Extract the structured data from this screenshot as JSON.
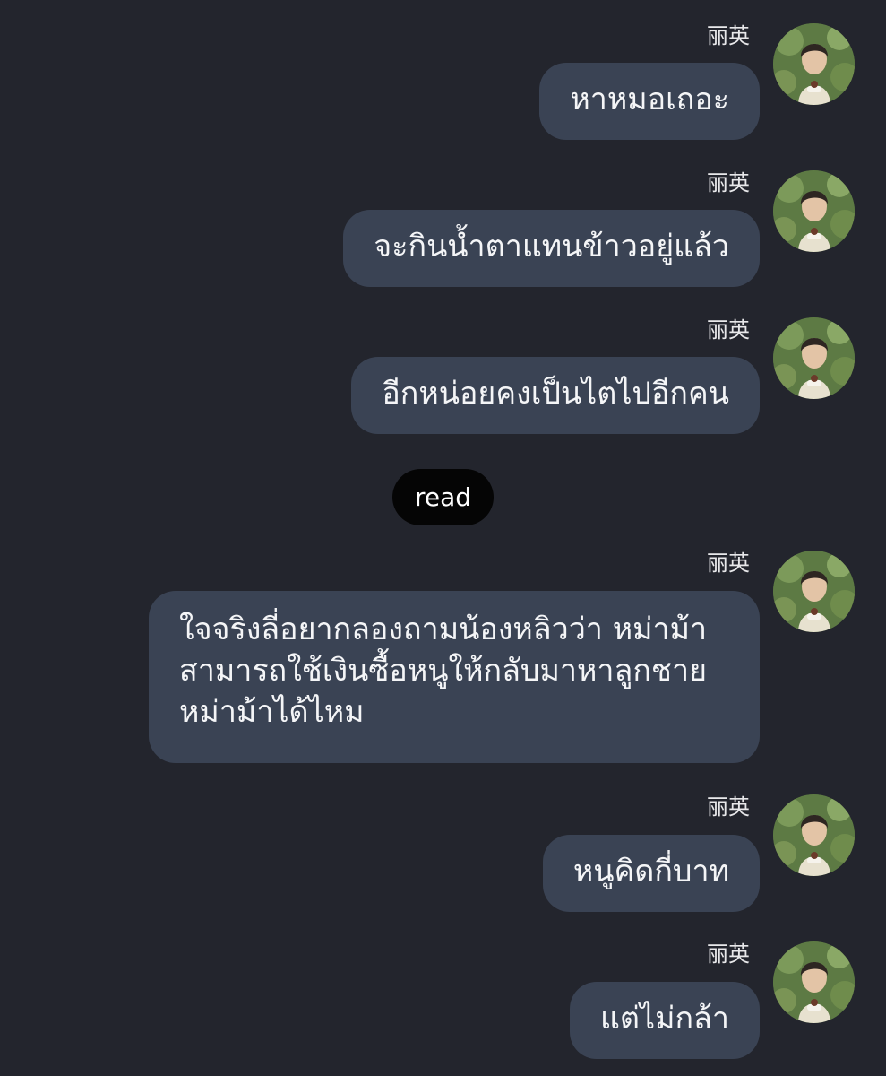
{
  "read_label": "read",
  "messages": [
    {
      "sender": "丽英",
      "text": "หาหมอเถอะ"
    },
    {
      "sender": "丽英",
      "text": "จะกินน้ำตาแทนข้าวอยู่แล้ว"
    },
    {
      "sender": "丽英",
      "text": "อีกหน่อยคงเป็นไตไปอีกคน"
    },
    {
      "sender": "丽英",
      "lines": [
        "ใจจริงลี่อยากลองถามน้องหลิวว่า หม่าม้า",
        "สามารถใช้เงินซื้อหนูให้กลับมาหาลูกชาย",
        "หม่าม้าได้ไหม"
      ]
    },
    {
      "sender": "丽英",
      "text": "หนูคิดกี่บาท"
    },
    {
      "sender": "丽英",
      "text": "แต่ไม่กล้า"
    }
  ]
}
